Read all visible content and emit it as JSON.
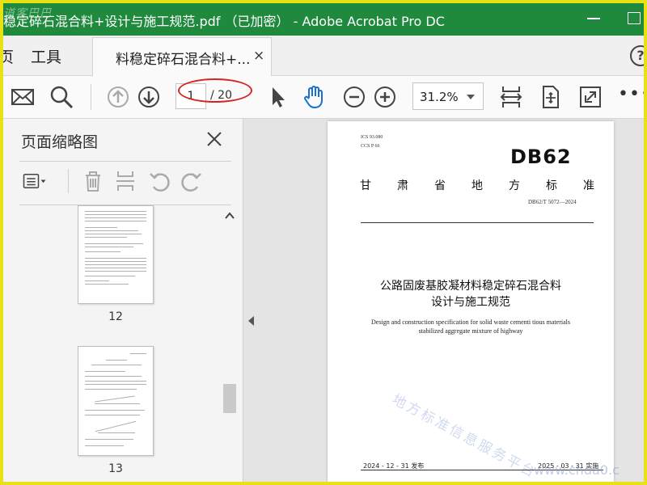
{
  "window": {
    "title": "稳定碎石混合料+设计与施工规范.pdf （已加密） - Adobe Acrobat Pro DC",
    "watermark_logo": "道客巴巴"
  },
  "tabs": {
    "home": "页",
    "tools": "工具",
    "document_tab": "料稳定碎石混合料+...",
    "close": "×",
    "help": "?"
  },
  "toolbar": {
    "current_page": "1",
    "total_pages": "/ 20",
    "zoom": "31.2%",
    "more": "•••",
    "icons": [
      "mail-icon",
      "search-icon",
      "page-up-icon",
      "page-down-icon",
      "select-cursor-icon",
      "hand-tool-icon",
      "zoom-out-icon",
      "zoom-in-icon",
      "fit-page-icon",
      "scroll-mode-icon",
      "full-screen-icon",
      "more-icon"
    ],
    "highlight_color": "#d42525"
  },
  "thumbnail_panel": {
    "title": "页面缩略图",
    "thumbnails": [
      {
        "label": "12"
      },
      {
        "label": "13"
      }
    ],
    "icons": [
      "options-icon",
      "delete-icon",
      "extract-icon",
      "rotate-left-icon",
      "rotate-right-icon"
    ]
  },
  "pdf_page": {
    "ics": "ICS  93.080",
    "ccs": "CCS  P 66",
    "logo": "DB62",
    "level_chars": [
      "甘",
      "肃",
      "省",
      "地",
      "方",
      "标",
      "准"
    ],
    "standard_number": "DB62/T 5072—2024",
    "title_cn_line1": "公路固废基胶凝材料稳定碎石混合料",
    "title_cn_line2": "设计与施工规范",
    "title_en_line1": "Design and construction specification for solid waste cementi tious materials",
    "title_en_line2": "stabilized aggregate mixture of highway",
    "watermark": "地方标准信息服务平台",
    "issue_date": "2024 - 12 - 31 发布",
    "impl_date": "2025 - 03 - 31 实施"
  },
  "site_watermark": "www.chda0.c",
  "colors": {
    "titlebar": "#1f8a3e",
    "outer_border": "#e8e214"
  }
}
